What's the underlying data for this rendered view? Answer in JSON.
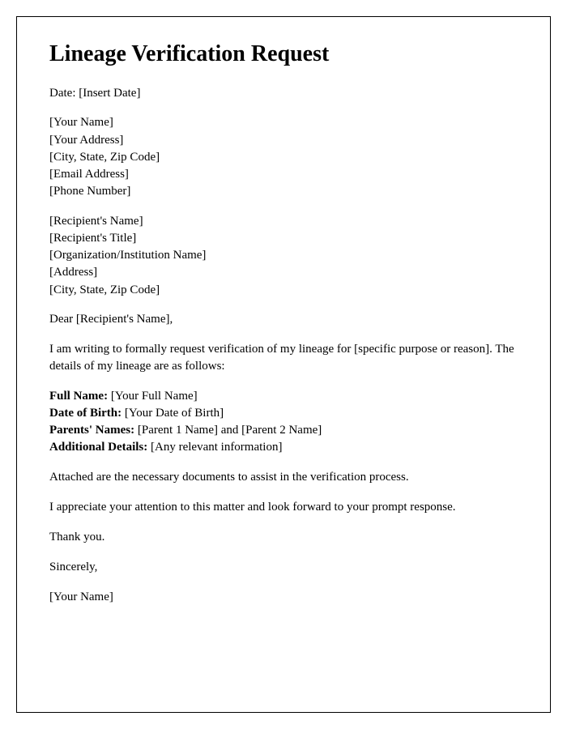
{
  "title": "Lineage Verification Request",
  "date_label": "Date:",
  "date_value": "[Insert Date]",
  "sender": {
    "name": "[Your Name]",
    "address": "[Your Address]",
    "city_state_zip": "[City, State, Zip Code]",
    "email": "[Email Address]",
    "phone": "[Phone Number]"
  },
  "recipient": {
    "name": "[Recipient's Name]",
    "title": "[Recipient's Title]",
    "org": "[Organization/Institution Name]",
    "address": "[Address]",
    "city_state_zip": "[City, State, Zip Code]"
  },
  "salutation": "Dear [Recipient's Name],",
  "intro": "I am writing to formally request verification of my lineage for [specific purpose or reason]. The details of my lineage are as follows:",
  "details": {
    "full_name_label": "Full Name:",
    "full_name_value": "[Your Full Name]",
    "dob_label": "Date of Birth:",
    "dob_value": "[Your Date of Birth]",
    "parents_label": "Parents' Names:",
    "parents_value": "[Parent 1 Name] and [Parent 2 Name]",
    "additional_label": "Additional Details:",
    "additional_value": "[Any relevant information]"
  },
  "attached": "Attached are the necessary documents to assist in the verification process.",
  "appreciate": "I appreciate your attention to this matter and look forward to your prompt response.",
  "thank_you": "Thank you.",
  "closing": "Sincerely,",
  "signature": "[Your Name]"
}
